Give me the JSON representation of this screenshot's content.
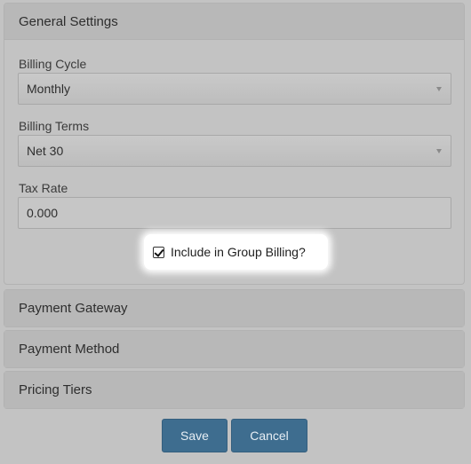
{
  "general_settings": {
    "title": "General Settings",
    "billing_cycle": {
      "label": "Billing Cycle",
      "value": "Monthly"
    },
    "billing_terms": {
      "label": "Billing Terms",
      "value": "Net 30"
    },
    "tax_rate": {
      "label": "Tax Rate",
      "value": "0.000"
    },
    "group_billing": {
      "label": "Include in Group Billing?",
      "checked": true
    }
  },
  "sections": {
    "payment_gateway": "Payment Gateway",
    "payment_method": "Payment Method",
    "pricing_tiers": "Pricing Tiers"
  },
  "actions": {
    "save_label": "Save",
    "cancel_label": "Cancel"
  },
  "colors": {
    "overlay_background": "#c3c3c3",
    "button_primary": "#3e6d8f",
    "highlight": "#ffffff"
  }
}
